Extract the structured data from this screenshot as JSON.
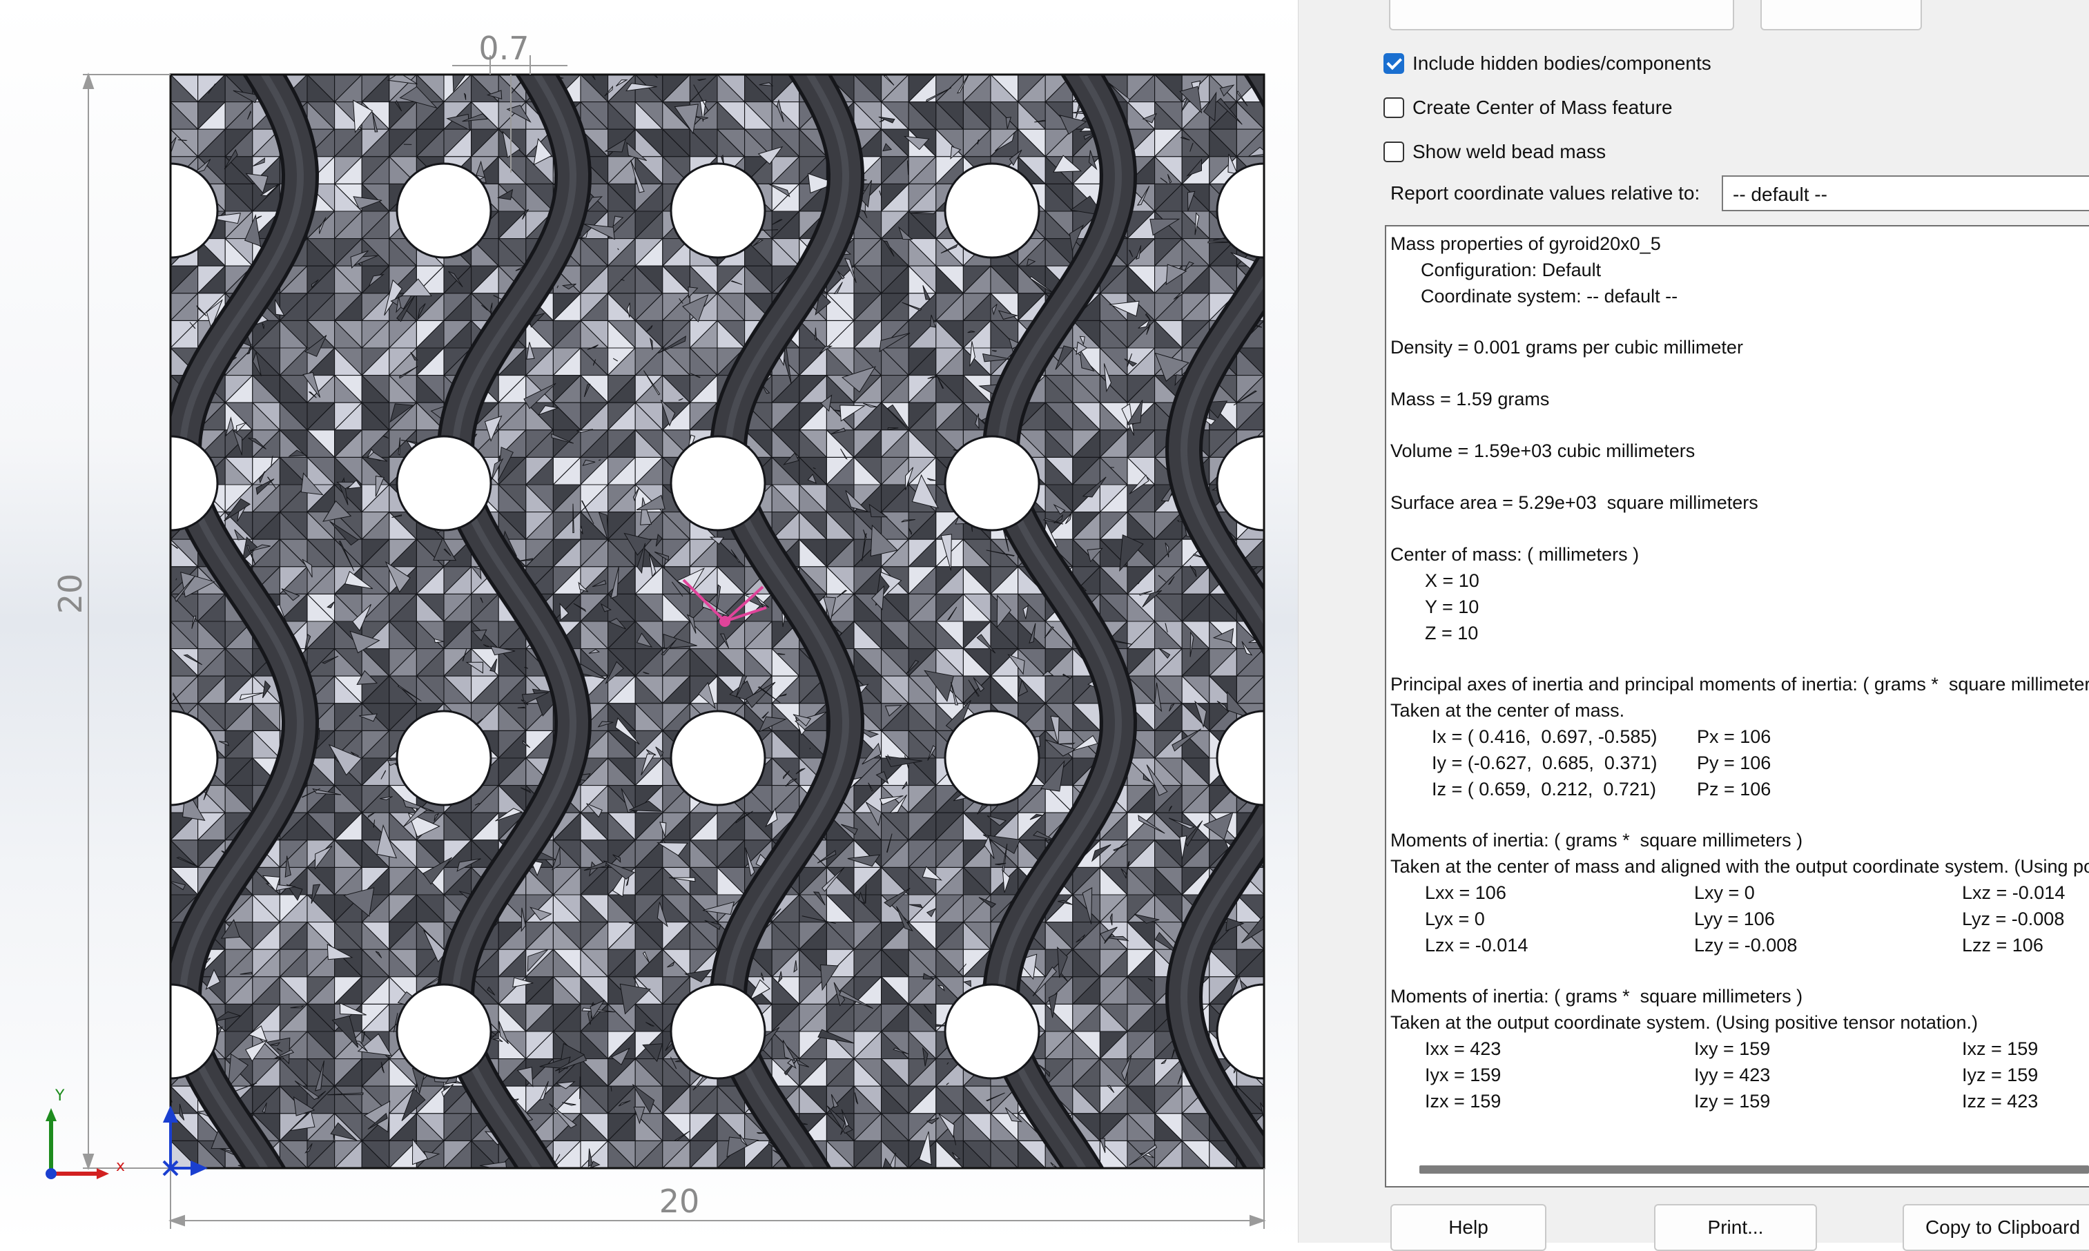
{
  "viewport": {
    "dimension_top": "0.7",
    "dimension_left": "20",
    "dimension_bottom": "20",
    "triad_y_label": "Y",
    "triad_x_label": "x",
    "colors": {
      "mesh_dark": "#4b4d55",
      "mesh_light": "#d6d8e2",
      "edges": "#111111",
      "rib": "#3b3c42",
      "dimension": "#9a9a9a",
      "triad_y": "#1e8c1e",
      "triad_x": "#d22020",
      "center_marker": "#e0449a"
    }
  },
  "options": {
    "include_hidden": {
      "label": "Include hidden bodies/components",
      "checked": true
    },
    "create_com": {
      "label": "Create Center of Mass feature",
      "checked": false
    },
    "weld_bead": {
      "label": "Show weld bead mass",
      "checked": false
    }
  },
  "coord": {
    "label": "Report coordinate values relative to:",
    "value": "-- default --"
  },
  "report": {
    "title": "Mass properties of gyroid20x0_5",
    "configuration": "Configuration: Default",
    "coordinate_system": "Coordinate system: -- default --",
    "density": "Density = 0.001 grams per cubic millimeter",
    "mass": "Mass = 1.59 grams",
    "volume": "Volume = 1.59e+03 cubic millimeters",
    "surface_area": "Surface area = 5.29e+03  square millimeters",
    "com_header": "Center of mass: ( millimeters )",
    "com_x": "X = 10",
    "com_y": "Y = 10",
    "com_z": "Z = 10",
    "principal_header": "Principal axes of inertia and principal moments of inertia: ( grams *  square millimeters )",
    "principal_sub": "Taken at the center of mass.",
    "principal_rows": [
      {
        "axis": "Ix = ( 0.416,  0.697, -0.585)",
        "moment": "Px = 106"
      },
      {
        "axis": "Iy = (-0.627,  0.685,  0.371)",
        "moment": "Py = 106"
      },
      {
        "axis": "Iz = ( 0.659,  0.212,  0.721)",
        "moment": "Pz = 106"
      }
    ],
    "moi_com_header": "Moments of inertia: ( grams *  square millimeters )",
    "moi_com_sub": "Taken at the center of mass and aligned with the output coordinate system. (Using positive tensor notation.)",
    "moi_com_rows": [
      [
        "Lxx = 106",
        "Lxy = 0",
        "Lxz = -0.014"
      ],
      [
        "Lyx = 0",
        "Lyy = 106",
        "Lyz = -0.008"
      ],
      [
        "Lzx = -0.014",
        "Lzy = -0.008",
        "Lzz = 106"
      ]
    ],
    "moi_out_header": "Moments of inertia: ( grams *  square millimeters )",
    "moi_out_sub": "Taken at the output coordinate system. (Using positive tensor notation.)",
    "moi_out_rows": [
      [
        "Ixx = 423",
        "Ixy = 159",
        "Ixz = 159"
      ],
      [
        "Iyx = 159",
        "Iyy = 423",
        "Iyz = 159"
      ],
      [
        "Izx = 159",
        "Izy = 159",
        "Izz = 423"
      ]
    ]
  },
  "buttons": {
    "help": "Help",
    "print": "Print...",
    "copy": "Copy to Clipboard"
  }
}
